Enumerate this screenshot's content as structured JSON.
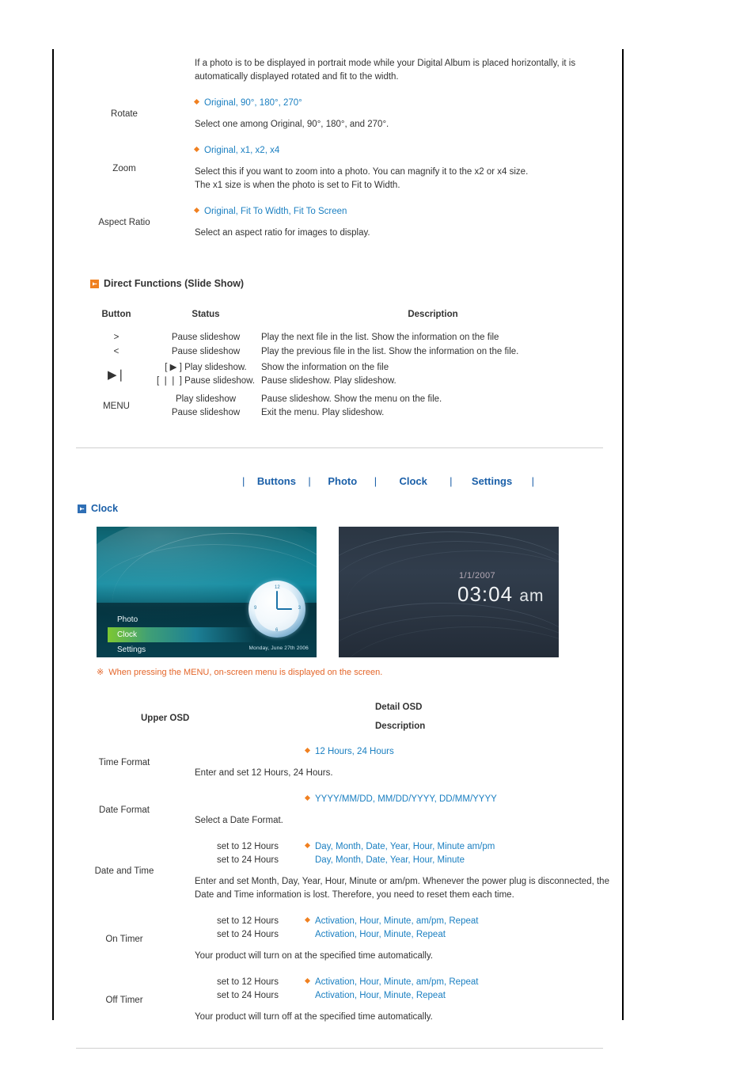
{
  "colors": {
    "link_blue": "#1a7fc1",
    "heading_blue": "#1a5fa8",
    "bullet_orange": "#f08020",
    "note_orange": "#e4662a"
  },
  "photo_settings": {
    "intro": "If a photo is to be displayed in portrait mode while your Digital Album is placed horizontally, it is automatically displayed rotated and fit to the width.",
    "rows": [
      {
        "label": "Rotate",
        "options": "Original, 90°, 180°, 270°",
        "desc": [
          "Select one among Original, 90°, 180°, and 270°."
        ]
      },
      {
        "label": "Zoom",
        "options": "Original, x1, x2, x4",
        "desc": [
          "Select this if you want to zoom into a photo. You can magnify it to the x2 or x4 size.",
          "The x1 size is when the photo is set to Fit to Width."
        ]
      },
      {
        "label": "Aspect Ratio",
        "options": "Original, Fit To Width, Fit To Screen",
        "desc": [
          "Select an aspect ratio for images to display."
        ]
      }
    ]
  },
  "direct_functions": {
    "heading": "Direct Functions (Slide Show)",
    "columns": [
      "Button",
      "Status",
      "Description"
    ],
    "rows": [
      {
        "button": ">",
        "lines": [
          {
            "status": "Pause slideshow",
            "desc": "Play the next file in the list. Show the information on the file"
          }
        ]
      },
      {
        "button": "<",
        "lines": [
          {
            "status": "Pause slideshow",
            "desc": "Play the previous file in the list. Show the information on the file."
          }
        ]
      },
      {
        "button": "▶❘",
        "lines": [
          {
            "status": "[ ▶ ] Play slideshow.",
            "desc": "Show the information on the file"
          },
          {
            "status": "[ ❘❘ ] Pause slideshow.",
            "desc": "Pause slideshow. Play slideshow."
          }
        ]
      },
      {
        "button": "MENU",
        "lines": [
          {
            "status": "Play slideshow",
            "desc": "Pause slideshow. Show the menu on the file."
          },
          {
            "status": "Pause slideshow",
            "desc": "Exit the menu. Play slideshow."
          }
        ]
      }
    ]
  },
  "nav": {
    "separator": "|",
    "items": [
      {
        "label": "Buttons"
      },
      {
        "label": "Photo"
      },
      {
        "label": "Clock"
      },
      {
        "label": "Settings"
      }
    ]
  },
  "clock_section": {
    "heading": "Clock",
    "screenshot_left": {
      "menu": [
        "Photo",
        "Clock",
        "Settings"
      ],
      "active_menu": "Clock",
      "date": "Monday, June 27th 2006",
      "clock_numbers": [
        "12",
        "3",
        "6",
        "9"
      ]
    },
    "screenshot_right": {
      "date": "1/1/2007",
      "time": "03:04",
      "ampm": "am"
    },
    "note": {
      "mark": "※",
      "text": "When pressing the MENU, on-screen menu is displayed on the screen."
    },
    "table_headers": {
      "upper_osd": "Upper OSD",
      "detail_osd": "Detail OSD",
      "description": "Description"
    },
    "rows": [
      {
        "label": "Time Format",
        "pairs": [
          {
            "cond": "",
            "value": "12 Hours, 24 Hours",
            "bullet": true
          }
        ],
        "desc": [
          "Enter and set 12 Hours, 24 Hours."
        ]
      },
      {
        "label": "Date Format",
        "pairs": [
          {
            "cond": "",
            "value": "YYYY/MM/DD, MM/DD/YYYY, DD/MM/YYYY",
            "bullet": true
          }
        ],
        "desc": [
          "Select a Date Format."
        ]
      },
      {
        "label": "Date and Time",
        "pairs": [
          {
            "cond": "set to 12 Hours",
            "value": "Day, Month, Date, Year, Hour, Minute am/pm",
            "bullet": true
          },
          {
            "cond": "set to 24 Hours",
            "value": "Day, Month, Date, Year, Hour, Minute",
            "bullet": false
          }
        ],
        "desc": [
          "Enter and set Month, Day, Year, Hour, Minute or am/pm. Whenever the power plug is disconnected, the",
          "Date and Time information is lost. Therefore, you need to reset them each time."
        ]
      },
      {
        "label": "On Timer",
        "pairs": [
          {
            "cond": "set to 12 Hours",
            "value": "Activation, Hour, Minute, am/pm, Repeat",
            "bullet": true
          },
          {
            "cond": "set to 24 Hours",
            "value": "Activation, Hour, Minute, Repeat",
            "bullet": false
          }
        ],
        "desc": [
          "Your product will turn on at the specified time automatically."
        ]
      },
      {
        "label": "Off Timer",
        "pairs": [
          {
            "cond": "set to 12 Hours",
            "value": "Activation, Hour, Minute, am/pm, Repeat",
            "bullet": true
          },
          {
            "cond": "set to 24 Hours",
            "value": "Activation, Hour, Minute, Repeat",
            "bullet": false
          }
        ],
        "desc": [
          "Your product will turn off at the specified time automatically."
        ]
      }
    ]
  }
}
